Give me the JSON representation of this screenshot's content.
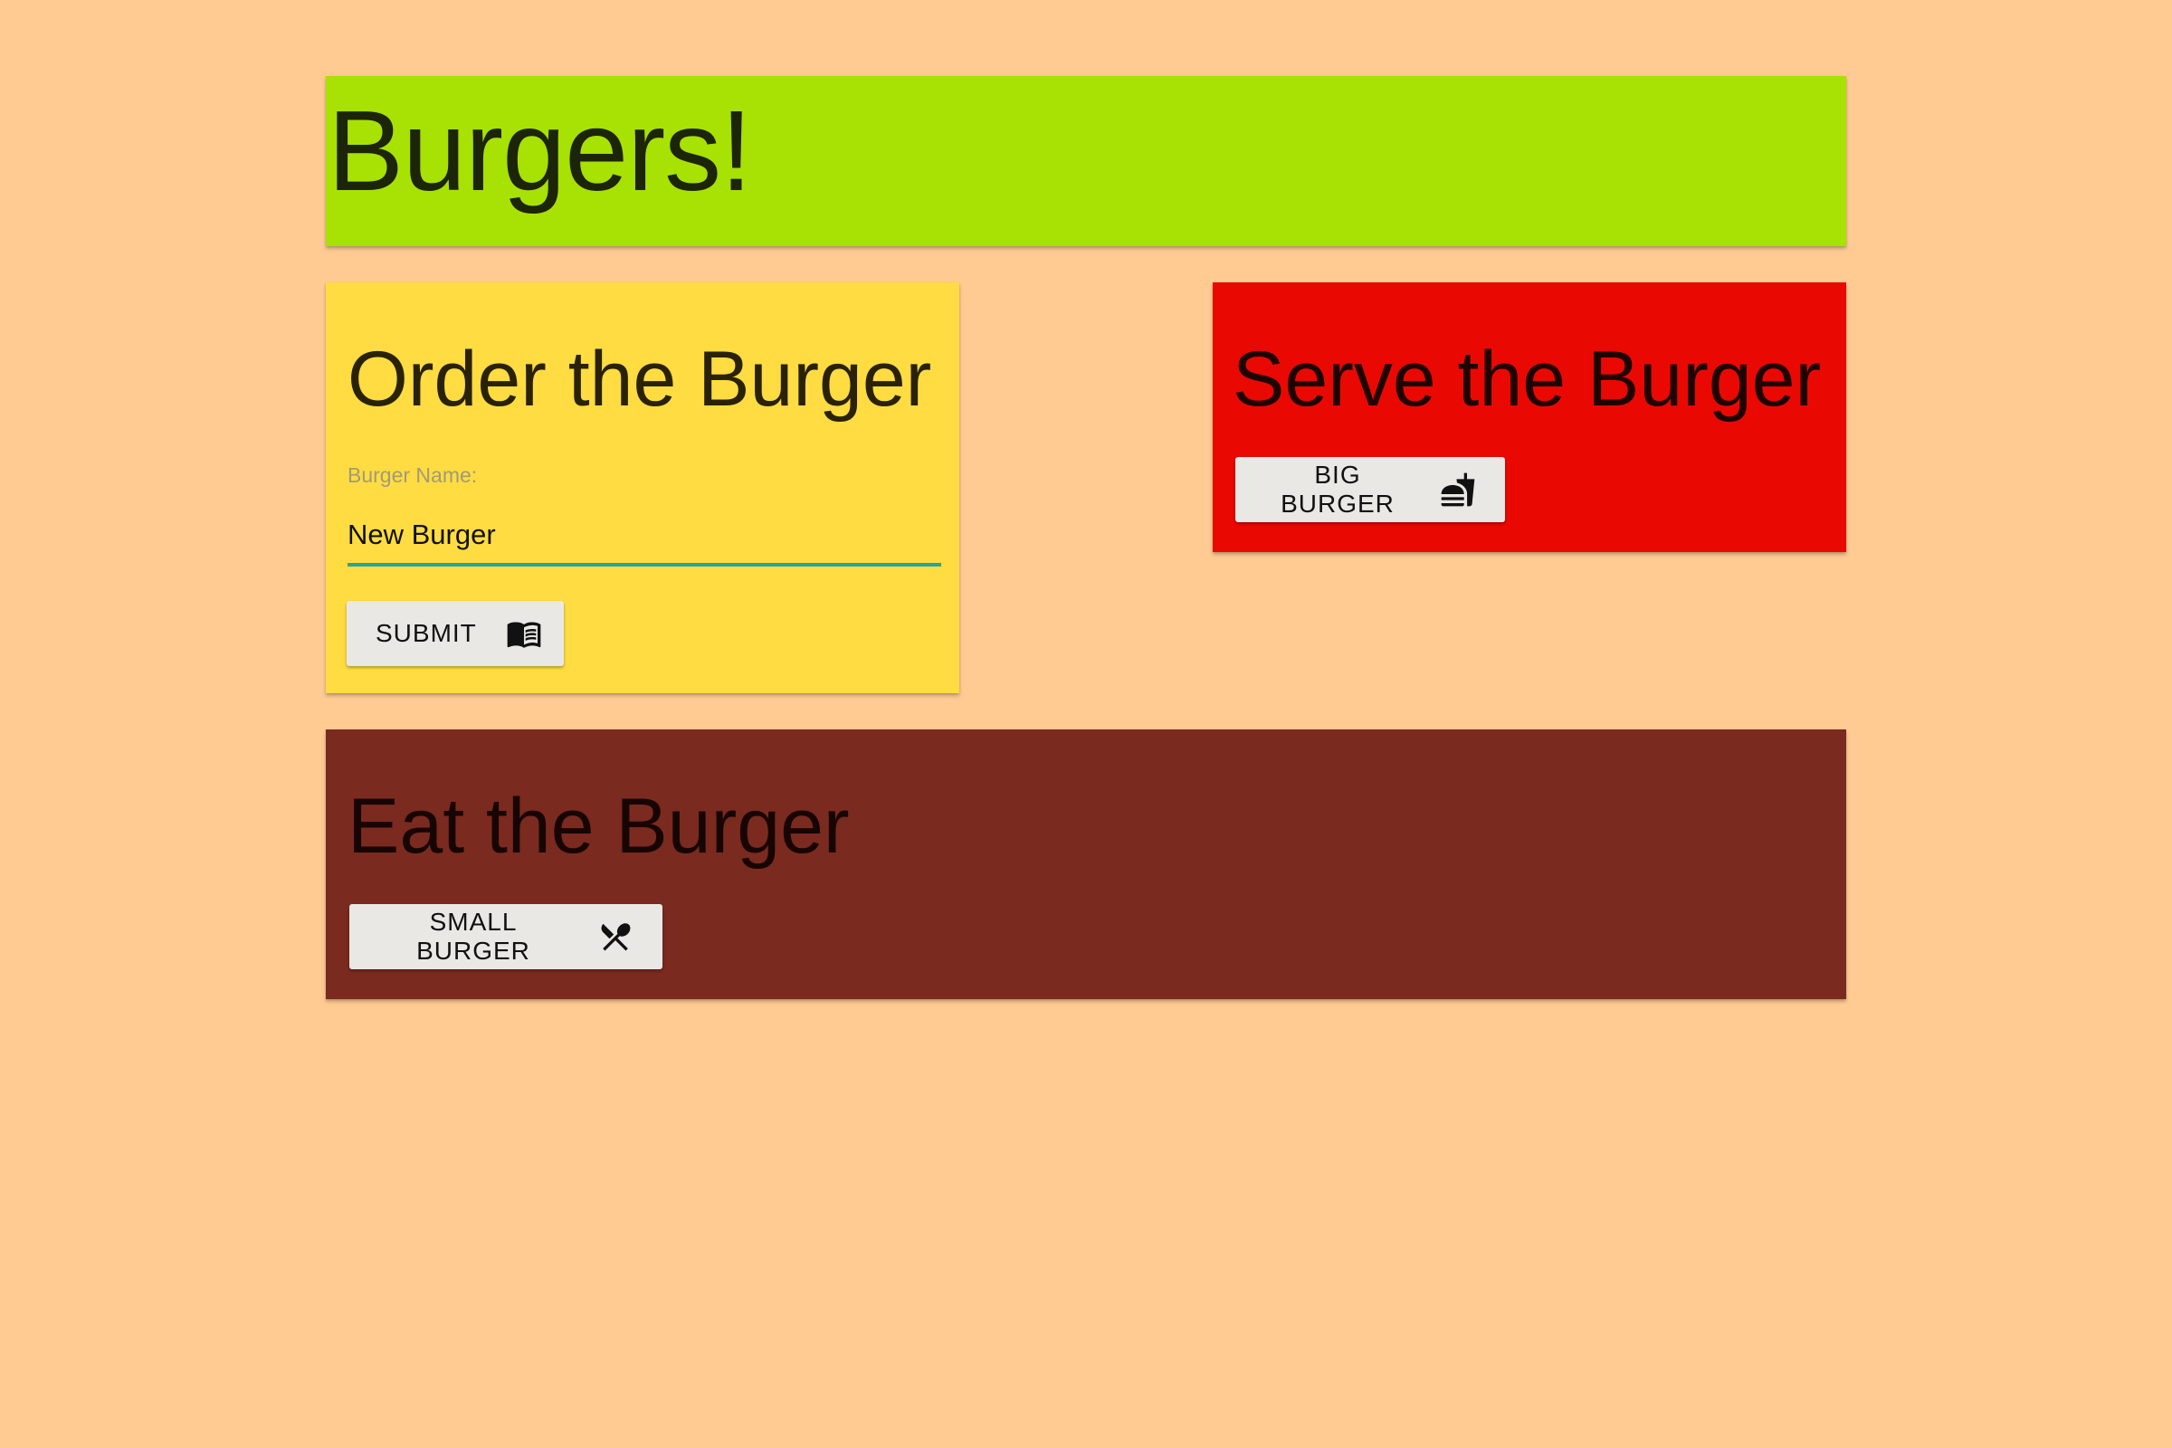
{
  "header": {
    "title": "Burgers!"
  },
  "order_card": {
    "title": "Order the Burger",
    "field_label": "Burger Name:",
    "field_value": "New Burger",
    "submit_label": "SUBMIT",
    "submit_icon": "menu-book-icon"
  },
  "serve_card": {
    "title": "Serve the Burger",
    "button_label": "BIG BURGER",
    "button_icon": "fastfood-icon"
  },
  "eat_card": {
    "title": "Eat the Burger",
    "button_label": "SMALL BURGER",
    "button_icon": "utensils-icon"
  },
  "colors": {
    "page_background": "#ffcb93",
    "header_background": "#a8e104",
    "order_background": "#ffdc41",
    "serve_background": "#e90902",
    "eat_background": "#7b2a1f",
    "input_underline": "#26a69a",
    "button_background": "#e9e8e4"
  }
}
